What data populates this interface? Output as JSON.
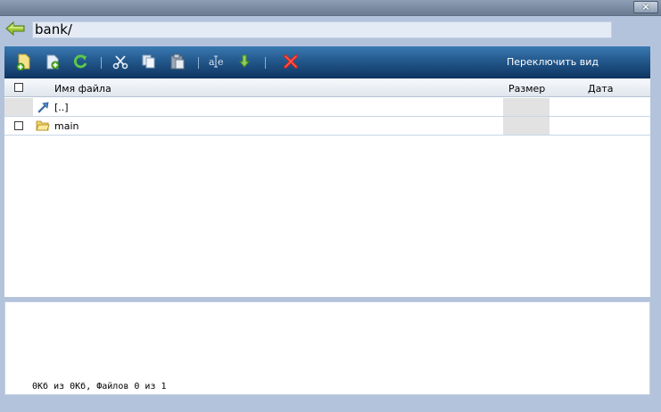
{
  "window": {
    "close_label": "×"
  },
  "pathbar": {
    "path": "bank/"
  },
  "toolbar": {
    "switch_view_label": "Переключить вид",
    "icons": [
      "new-file-icon",
      "new-folder-icon",
      "refresh-icon",
      "cut-icon",
      "copy-icon",
      "paste-icon",
      "rename-icon",
      "download-icon",
      "delete-icon"
    ]
  },
  "grid": {
    "columns": {
      "name": "Имя файла",
      "size": "Размер",
      "date": "Дата"
    },
    "rows": [
      {
        "name": "[..]",
        "type": "parent",
        "size": "",
        "date": ""
      },
      {
        "name": "main",
        "type": "folder",
        "size": "",
        "date": ""
      }
    ]
  },
  "status": {
    "text": "0Кб из 0Кб, Файлов 0 из 1"
  },
  "colors": {
    "toolbar_top": "#3a79b2",
    "toolbar_bottom": "#0d3460",
    "background": "#b3c3dc"
  }
}
